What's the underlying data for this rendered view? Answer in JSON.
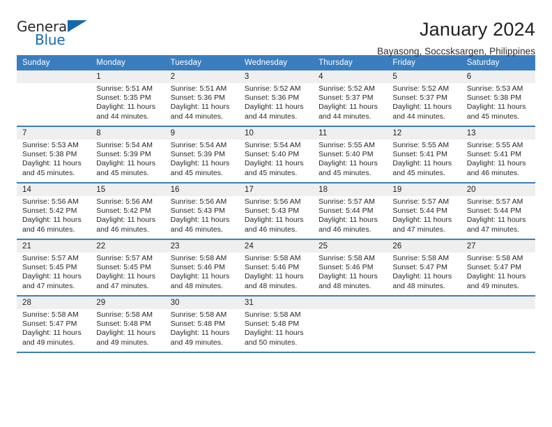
{
  "brand": {
    "name_part1": "General",
    "name_part2": "Blue",
    "logo_icon": "triangle-flag-icon"
  },
  "header": {
    "title": "January 2024",
    "subtitle": "Bayasong, Soccsksargen, Philippines"
  },
  "colors": {
    "accent_blue": "#3a7ebf",
    "logo_blue": "#1569b0",
    "daynum_background": "#efefef",
    "text": "#262626"
  },
  "weekday_headers": [
    "Sunday",
    "Monday",
    "Tuesday",
    "Wednesday",
    "Thursday",
    "Friday",
    "Saturday"
  ],
  "weeks": [
    [
      {
        "day": "",
        "sunrise": "",
        "sunset": "",
        "daylight_line1": "",
        "daylight_line2": ""
      },
      {
        "day": "1",
        "sunrise": "Sunrise: 5:51 AM",
        "sunset": "Sunset: 5:35 PM",
        "daylight_line1": "Daylight: 11 hours",
        "daylight_line2": "and 44 minutes."
      },
      {
        "day": "2",
        "sunrise": "Sunrise: 5:51 AM",
        "sunset": "Sunset: 5:36 PM",
        "daylight_line1": "Daylight: 11 hours",
        "daylight_line2": "and 44 minutes."
      },
      {
        "day": "3",
        "sunrise": "Sunrise: 5:52 AM",
        "sunset": "Sunset: 5:36 PM",
        "daylight_line1": "Daylight: 11 hours",
        "daylight_line2": "and 44 minutes."
      },
      {
        "day": "4",
        "sunrise": "Sunrise: 5:52 AM",
        "sunset": "Sunset: 5:37 PM",
        "daylight_line1": "Daylight: 11 hours",
        "daylight_line2": "and 44 minutes."
      },
      {
        "day": "5",
        "sunrise": "Sunrise: 5:52 AM",
        "sunset": "Sunset: 5:37 PM",
        "daylight_line1": "Daylight: 11 hours",
        "daylight_line2": "and 44 minutes."
      },
      {
        "day": "6",
        "sunrise": "Sunrise: 5:53 AM",
        "sunset": "Sunset: 5:38 PM",
        "daylight_line1": "Daylight: 11 hours",
        "daylight_line2": "and 45 minutes."
      }
    ],
    [
      {
        "day": "7",
        "sunrise": "Sunrise: 5:53 AM",
        "sunset": "Sunset: 5:38 PM",
        "daylight_line1": "Daylight: 11 hours",
        "daylight_line2": "and 45 minutes."
      },
      {
        "day": "8",
        "sunrise": "Sunrise: 5:54 AM",
        "sunset": "Sunset: 5:39 PM",
        "daylight_line1": "Daylight: 11 hours",
        "daylight_line2": "and 45 minutes."
      },
      {
        "day": "9",
        "sunrise": "Sunrise: 5:54 AM",
        "sunset": "Sunset: 5:39 PM",
        "daylight_line1": "Daylight: 11 hours",
        "daylight_line2": "and 45 minutes."
      },
      {
        "day": "10",
        "sunrise": "Sunrise: 5:54 AM",
        "sunset": "Sunset: 5:40 PM",
        "daylight_line1": "Daylight: 11 hours",
        "daylight_line2": "and 45 minutes."
      },
      {
        "day": "11",
        "sunrise": "Sunrise: 5:55 AM",
        "sunset": "Sunset: 5:40 PM",
        "daylight_line1": "Daylight: 11 hours",
        "daylight_line2": "and 45 minutes."
      },
      {
        "day": "12",
        "sunrise": "Sunrise: 5:55 AM",
        "sunset": "Sunset: 5:41 PM",
        "daylight_line1": "Daylight: 11 hours",
        "daylight_line2": "and 45 minutes."
      },
      {
        "day": "13",
        "sunrise": "Sunrise: 5:55 AM",
        "sunset": "Sunset: 5:41 PM",
        "daylight_line1": "Daylight: 11 hours",
        "daylight_line2": "and 46 minutes."
      }
    ],
    [
      {
        "day": "14",
        "sunrise": "Sunrise: 5:56 AM",
        "sunset": "Sunset: 5:42 PM",
        "daylight_line1": "Daylight: 11 hours",
        "daylight_line2": "and 46 minutes."
      },
      {
        "day": "15",
        "sunrise": "Sunrise: 5:56 AM",
        "sunset": "Sunset: 5:42 PM",
        "daylight_line1": "Daylight: 11 hours",
        "daylight_line2": "and 46 minutes."
      },
      {
        "day": "16",
        "sunrise": "Sunrise: 5:56 AM",
        "sunset": "Sunset: 5:43 PM",
        "daylight_line1": "Daylight: 11 hours",
        "daylight_line2": "and 46 minutes."
      },
      {
        "day": "17",
        "sunrise": "Sunrise: 5:56 AM",
        "sunset": "Sunset: 5:43 PM",
        "daylight_line1": "Daylight: 11 hours",
        "daylight_line2": "and 46 minutes."
      },
      {
        "day": "18",
        "sunrise": "Sunrise: 5:57 AM",
        "sunset": "Sunset: 5:44 PM",
        "daylight_line1": "Daylight: 11 hours",
        "daylight_line2": "and 46 minutes."
      },
      {
        "day": "19",
        "sunrise": "Sunrise: 5:57 AM",
        "sunset": "Sunset: 5:44 PM",
        "daylight_line1": "Daylight: 11 hours",
        "daylight_line2": "and 47 minutes."
      },
      {
        "day": "20",
        "sunrise": "Sunrise: 5:57 AM",
        "sunset": "Sunset: 5:44 PM",
        "daylight_line1": "Daylight: 11 hours",
        "daylight_line2": "and 47 minutes."
      }
    ],
    [
      {
        "day": "21",
        "sunrise": "Sunrise: 5:57 AM",
        "sunset": "Sunset: 5:45 PM",
        "daylight_line1": "Daylight: 11 hours",
        "daylight_line2": "and 47 minutes."
      },
      {
        "day": "22",
        "sunrise": "Sunrise: 5:57 AM",
        "sunset": "Sunset: 5:45 PM",
        "daylight_line1": "Daylight: 11 hours",
        "daylight_line2": "and 47 minutes."
      },
      {
        "day": "23",
        "sunrise": "Sunrise: 5:58 AM",
        "sunset": "Sunset: 5:46 PM",
        "daylight_line1": "Daylight: 11 hours",
        "daylight_line2": "and 48 minutes."
      },
      {
        "day": "24",
        "sunrise": "Sunrise: 5:58 AM",
        "sunset": "Sunset: 5:46 PM",
        "daylight_line1": "Daylight: 11 hours",
        "daylight_line2": "and 48 minutes."
      },
      {
        "day": "25",
        "sunrise": "Sunrise: 5:58 AM",
        "sunset": "Sunset: 5:46 PM",
        "daylight_line1": "Daylight: 11 hours",
        "daylight_line2": "and 48 minutes."
      },
      {
        "day": "26",
        "sunrise": "Sunrise: 5:58 AM",
        "sunset": "Sunset: 5:47 PM",
        "daylight_line1": "Daylight: 11 hours",
        "daylight_line2": "and 48 minutes."
      },
      {
        "day": "27",
        "sunrise": "Sunrise: 5:58 AM",
        "sunset": "Sunset: 5:47 PM",
        "daylight_line1": "Daylight: 11 hours",
        "daylight_line2": "and 49 minutes."
      }
    ],
    [
      {
        "day": "28",
        "sunrise": "Sunrise: 5:58 AM",
        "sunset": "Sunset: 5:47 PM",
        "daylight_line1": "Daylight: 11 hours",
        "daylight_line2": "and 49 minutes."
      },
      {
        "day": "29",
        "sunrise": "Sunrise: 5:58 AM",
        "sunset": "Sunset: 5:48 PM",
        "daylight_line1": "Daylight: 11 hours",
        "daylight_line2": "and 49 minutes."
      },
      {
        "day": "30",
        "sunrise": "Sunrise: 5:58 AM",
        "sunset": "Sunset: 5:48 PM",
        "daylight_line1": "Daylight: 11 hours",
        "daylight_line2": "and 49 minutes."
      },
      {
        "day": "31",
        "sunrise": "Sunrise: 5:58 AM",
        "sunset": "Sunset: 5:48 PM",
        "daylight_line1": "Daylight: 11 hours",
        "daylight_line2": "and 50 minutes."
      },
      {
        "day": "",
        "sunrise": "",
        "sunset": "",
        "daylight_line1": "",
        "daylight_line2": ""
      },
      {
        "day": "",
        "sunrise": "",
        "sunset": "",
        "daylight_line1": "",
        "daylight_line2": ""
      },
      {
        "day": "",
        "sunrise": "",
        "sunset": "",
        "daylight_line1": "",
        "daylight_line2": ""
      }
    ]
  ]
}
